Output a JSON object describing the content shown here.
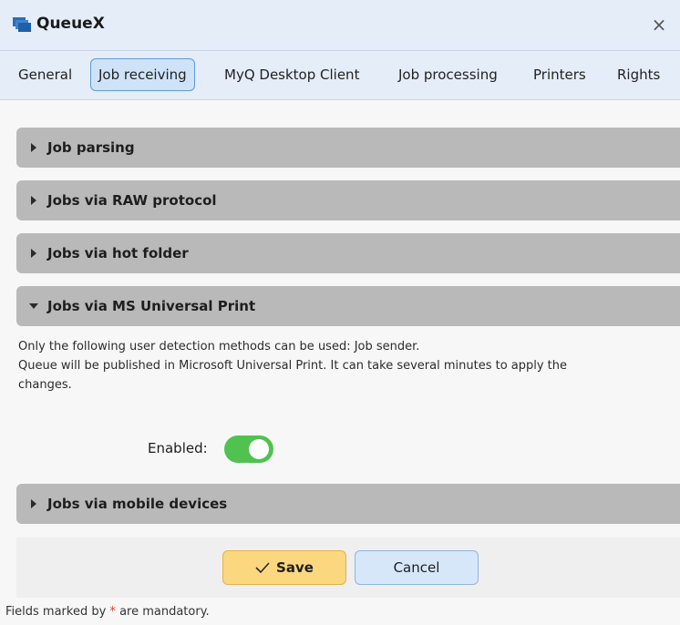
{
  "window": {
    "title": "QueueX",
    "close_glyph": "×",
    "icon": "queue-icon"
  },
  "tabs": [
    {
      "label": "General",
      "active": false
    },
    {
      "label": "Job receiving",
      "active": true
    },
    {
      "label": "MyQ Desktop Client",
      "active": false
    },
    {
      "label": "Job processing",
      "active": false
    },
    {
      "label": "Printers",
      "active": false
    },
    {
      "label": "Rights",
      "active": false
    }
  ],
  "sections": [
    {
      "label": "Job parsing",
      "expanded": false
    },
    {
      "label": "Jobs via RAW protocol",
      "expanded": false
    },
    {
      "label": "Jobs via hot folder",
      "expanded": false
    },
    {
      "label": "Jobs via MS Universal Print",
      "expanded": true
    },
    {
      "label": "Jobs via mobile devices",
      "expanded": false
    }
  ],
  "universal_print": {
    "info_line1": "Only the following user detection methods can be used: Job sender.",
    "info_line2": "Queue will be published in Microsoft Universal Print. It can take several minutes to apply the",
    "info_line3": "changes.",
    "enabled_label": "Enabled:",
    "enabled": true
  },
  "actions": {
    "save_label": "Save",
    "cancel_label": "Cancel"
  },
  "footer": {
    "mandatory_prefix": "Fields marked by",
    "mandatory_star": "*",
    "mandatory_suffix": "are mandatory."
  },
  "colors": {
    "toggle_on": "#4fc24f",
    "save_button": "#fbd77f",
    "cancel_button": "#d6e7f9",
    "active_tab": "#cfe3f8",
    "section_header": "#b9b9b9",
    "brand_icon": "#2f6db3"
  }
}
